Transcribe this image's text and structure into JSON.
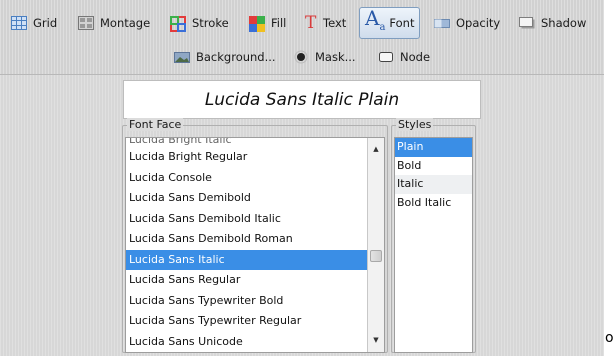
{
  "toolbar": {
    "items": [
      {
        "label": "Grid",
        "icon": "grid-icon"
      },
      {
        "label": "Montage",
        "icon": "montage-icon"
      },
      {
        "label": "Stroke",
        "icon": "stroke-icon"
      },
      {
        "label": "Fill",
        "icon": "fill-icon"
      },
      {
        "label": "Text",
        "icon": "text-icon"
      },
      {
        "label": "Font",
        "icon": "font-icon",
        "active": true
      },
      {
        "label": "Opacity",
        "icon": "opacity-icon"
      },
      {
        "label": "Shadow",
        "icon": "shadow-icon"
      }
    ],
    "row2": [
      {
        "label": "Background...",
        "icon": "background-icon"
      },
      {
        "label": "Mask...",
        "icon": "mask-icon"
      },
      {
        "label": "Node",
        "icon": "node-icon"
      }
    ],
    "font_icon_glyph": "A",
    "font_icon_sub": "a"
  },
  "preview": {
    "text": "Lucida Sans Italic Plain"
  },
  "font_face": {
    "label": "Font Face",
    "partial_item": "Lucida Bright Italic",
    "items": [
      "Lucida Bright Regular",
      "Lucida Console",
      "Lucida Sans Demibold",
      "Lucida Sans Demibold Italic",
      "Lucida Sans Demibold Roman",
      "Lucida Sans Italic",
      "Lucida Sans Regular",
      "Lucida Sans Typewriter Bold",
      "Lucida Sans Typewriter Regular",
      "Lucida Sans Unicode"
    ],
    "selected": "Lucida Sans Italic"
  },
  "styles": {
    "label": "Styles",
    "items": [
      "Plain",
      "Bold",
      "Italic",
      "Bold Italic"
    ],
    "selected": "Plain"
  },
  "stray_char": "o",
  "colors": {
    "selection": "#3a8ee6",
    "panel": "#dcdcdc",
    "active_button_border": "#7f9dbf"
  }
}
